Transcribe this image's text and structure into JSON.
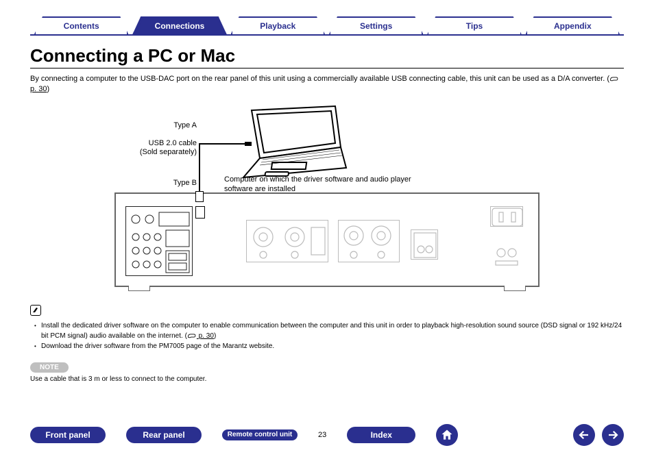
{
  "tabs": {
    "contents": "Contents",
    "connections": "Connections",
    "playback": "Playback",
    "settings": "Settings",
    "tips": "Tips",
    "appendix": "Appendix"
  },
  "heading": "Connecting a PC or Mac",
  "intro": "By connecting a computer to the USB-DAC port on the rear panel of this unit using a commercially available USB connecting cable, this unit can be used as a D/A converter.  (",
  "intro_ref": " p. 30",
  "intro_close": ")",
  "diagram": {
    "typeA": "Type A",
    "usbCable1": "USB 2.0 cable",
    "usbCable2": "(Sold separately)",
    "typeB": "Type B",
    "computerNote": "Computer on which the driver software and audio player software are installed"
  },
  "bullets": {
    "b1a": "Install the dedicated driver software on the computer to enable communication between the computer and this unit in order to playback high-resolution sound source (DSD signal or 192 kHz/24 bit PCM signal) audio available on the internet.  (",
    "b1ref": " p. 30",
    "b1b": ")",
    "b2": "Download the driver software from the PM7005 page of the Marantz website."
  },
  "notePill": "NOTE",
  "noteText": "Use a cable that is 3 m or less to connect to the computer.",
  "bottom": {
    "front": "Front panel",
    "rear": "Rear panel",
    "remote": "Remote control unit",
    "page": "23",
    "index": "Index"
  }
}
